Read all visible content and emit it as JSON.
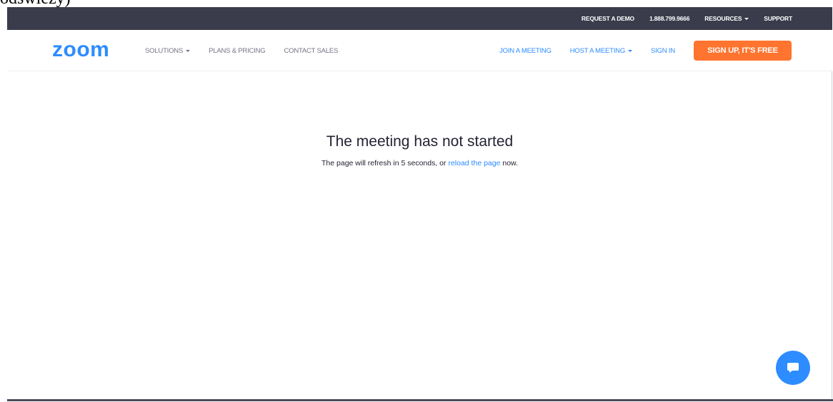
{
  "caption_fragment": "odswiezy)",
  "top_bar": {
    "request_demo": "REQUEST A DEMO",
    "phone": "1.888.799.9666",
    "resources": "RESOURCES",
    "support": "SUPPORT"
  },
  "nav": {
    "logo_text": "zoom",
    "solutions": "SOLUTIONS",
    "plans_pricing": "PLANS & PRICING",
    "contact_sales": "CONTACT SALES",
    "join_meeting": "JOIN A MEETING",
    "host_meeting": "HOST A MEETING",
    "sign_in": "SIGN IN",
    "signup": "SIGN UP, IT'S FREE"
  },
  "main": {
    "heading": "The meeting has not started",
    "message_before": "The page will refresh in 5 seconds, or ",
    "reload_link": "reload the page",
    "message_after": " now."
  },
  "icons": {
    "chat": "chat-bubble-icon",
    "dropdown": "caret-down-icon"
  },
  "colors": {
    "top_bar_bg": "#3a3b4b",
    "brand_blue": "#2d8cff",
    "signup_orange": "#ff742e",
    "nav_gray": "#747487",
    "text_dark": "#232333"
  }
}
